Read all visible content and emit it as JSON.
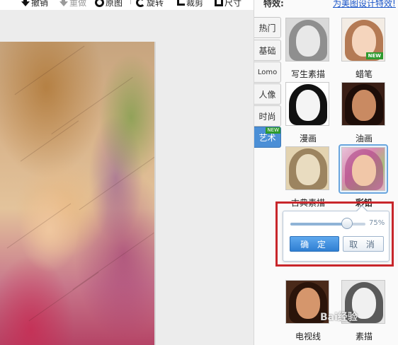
{
  "toolbar": {
    "undo": "撤销",
    "redo": "重做",
    "original": "原图",
    "rotate": "旋转",
    "crop": "裁剪",
    "resize": "尺寸"
  },
  "panel": {
    "title": "特效:",
    "link": "为美图设计特效!",
    "tabs": [
      {
        "label": "热门"
      },
      {
        "label": "基础"
      },
      {
        "label": "Lomo"
      },
      {
        "label": "人像"
      },
      {
        "label": "时尚"
      },
      {
        "label": "艺术",
        "badge": "NEW",
        "active": true
      }
    ],
    "effects": [
      {
        "label": "写生素描"
      },
      {
        "label": "蜡笔",
        "badge": "NEW"
      },
      {
        "label": "漫画"
      },
      {
        "label": "油画"
      },
      {
        "label": "古典素描"
      },
      {
        "label": "彩铅",
        "selected": true
      },
      {
        "label": "电视线"
      },
      {
        "label": "素描"
      }
    ]
  },
  "popup": {
    "slider_value": "75%",
    "slider_fraction": 0.75,
    "ok_label": "确 定",
    "cancel_label": "取 消"
  },
  "watermark": "Bai经验",
  "colors": {
    "active_tab": "#4b8fd6",
    "ok_button": "#2f7fd2",
    "highlight": "#c8262b",
    "link": "#1a55c8",
    "new_badge": "#2e9a2e"
  }
}
